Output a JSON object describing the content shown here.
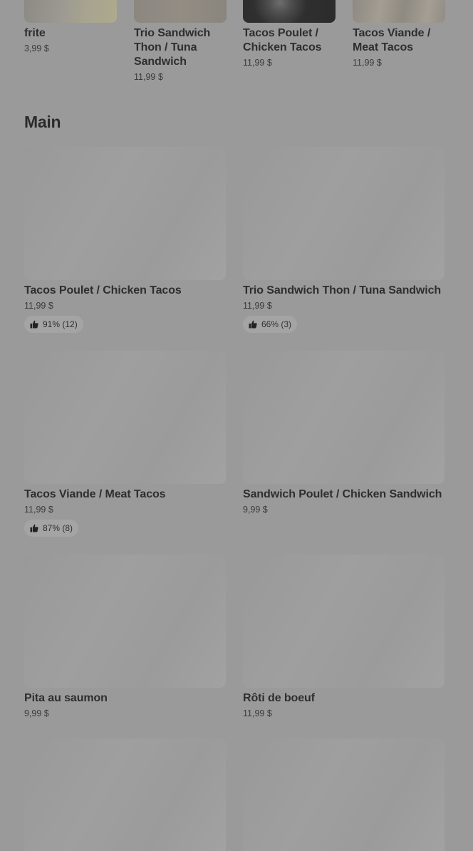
{
  "featured": [
    {
      "name": "frite",
      "price": "3,99 $",
      "thumb": "fries-photo"
    },
    {
      "name": "Trio Sandwich Thon / Tuna Sandwich",
      "price": "11,99 $",
      "thumb": "sandwich-photo"
    },
    {
      "name": "Tacos Poulet / Chicken Tacos",
      "price": "11,99 $",
      "thumb": "chicken-tacos-photo"
    },
    {
      "name": "Tacos Viande / Meat Tacos",
      "price": "11,99 $",
      "thumb": "meat-tacos-photo"
    }
  ],
  "section": {
    "title": "Main"
  },
  "items": [
    {
      "name": "Tacos Poulet / Chicken Tacos",
      "price": "11,99 $",
      "rating": "91% (12)",
      "rating_icon": "thumbs-up-icon"
    },
    {
      "name": "Trio Sandwich Thon / Tuna Sandwich",
      "price": "11,99 $",
      "rating": "66% (3)",
      "rating_icon": "thumbs-up-icon"
    },
    {
      "name": "Tacos Viande / Meat Tacos",
      "price": "11,99 $",
      "rating": "87% (8)",
      "rating_icon": "thumbs-up-icon"
    },
    {
      "name": "Sandwich Poulet / Chicken Sandwich",
      "price": "9,99 $"
    },
    {
      "name": "Pita au saumon",
      "price": "9,99 $"
    },
    {
      "name": "Rôti de boeuf",
      "price": "11,99 $"
    }
  ]
}
